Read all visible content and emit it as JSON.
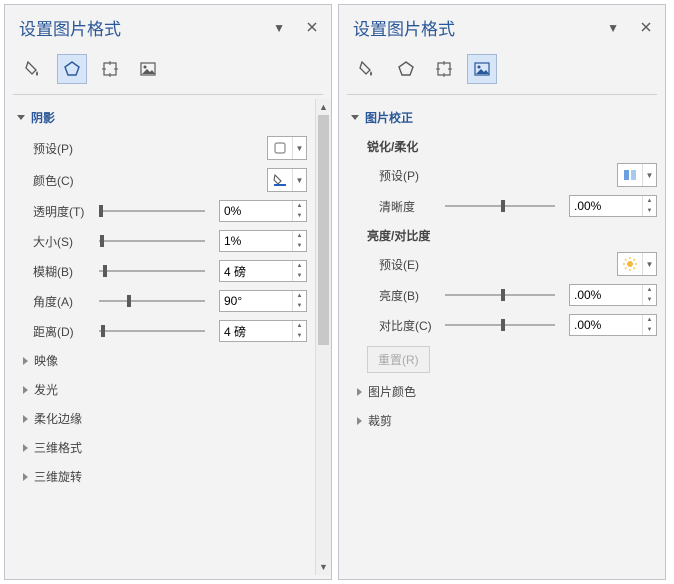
{
  "left": {
    "title": "设置图片格式",
    "sections": {
      "shadow": {
        "label": "阴影",
        "preset": "预设(P)",
        "color": "颜色(C)",
        "transparency": {
          "label": "透明度(T)",
          "value": "0%"
        },
        "size": {
          "label": "大小(S)",
          "value": "1%"
        },
        "blur": {
          "label": "模糊(B)",
          "value": "4 磅"
        },
        "angle": {
          "label": "角度(A)",
          "value": "90°"
        },
        "distance": {
          "label": "距离(D)",
          "value": "4 磅"
        }
      },
      "reflection": "映像",
      "glow": "发光",
      "softEdges": "柔化边缘",
      "threeDFormat": "三维格式",
      "threeDRotation": "三维旋转"
    }
  },
  "right": {
    "title": "设置图片格式",
    "sections": {
      "correction": {
        "label": "图片校正",
        "sharpen": {
          "label": "锐化/柔化",
          "preset": "预设(P)",
          "clarity": {
            "label": "清晰度",
            "value": ".00%"
          }
        },
        "brightContrast": {
          "label": "亮度/对比度",
          "preset": "预设(E)",
          "brightness": {
            "label": "亮度(B)",
            "value": ".00%"
          },
          "contrast": {
            "label": "对比度(C)",
            "value": ".00%"
          }
        },
        "reset": "重置(R)"
      },
      "pictureColor": "图片颜色",
      "crop": "裁剪"
    }
  }
}
